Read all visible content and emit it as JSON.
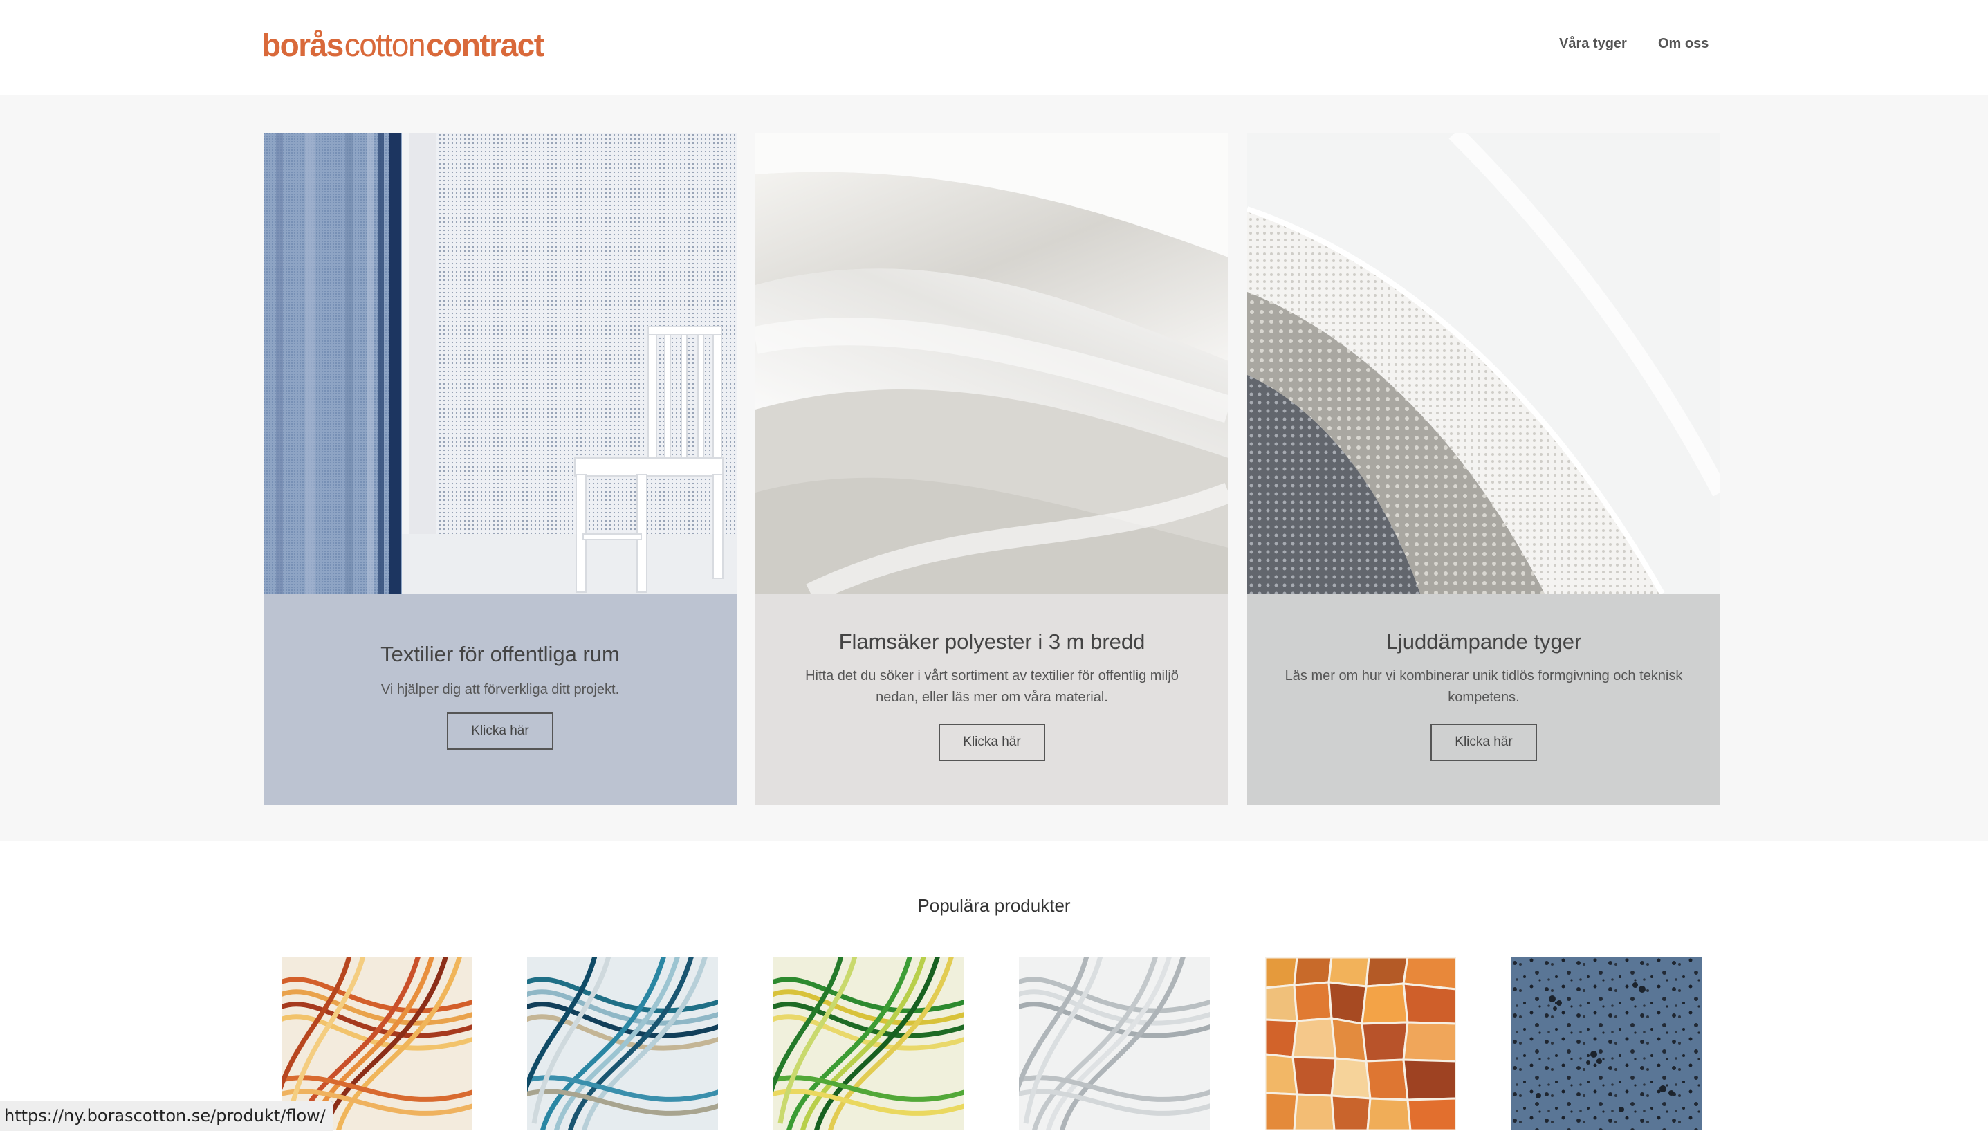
{
  "brand": {
    "part1": "borås",
    "part2": "cotton",
    "part3": "contract",
    "color": "#d9693a"
  },
  "nav": {
    "items": [
      "Våra tyger",
      "Om oss"
    ]
  },
  "hero": {
    "cards": [
      {
        "title": "Textilier för offentliga rum",
        "text": "Vi hjälper dig att förverkliga ditt projekt.",
        "button": "Klicka här",
        "color": "#bcc3d1"
      },
      {
        "title": "Flamsäker polyester i 3 m bredd",
        "text": "Hitta det du söker i vårt sortiment av textilier för offentlig miljö nedan, eller läs mer om våra material.",
        "button": "Klicka här",
        "color": "#e2e0df"
      },
      {
        "title": "Ljuddämpande tyger",
        "text": "Läs mer om hur vi kombinerar unik tidlös formgivning och teknisk kompetens.",
        "button": "Klicka här",
        "color": "#cfd0d0"
      }
    ]
  },
  "popular": {
    "title": "Populära produkter"
  },
  "status_url": "https://ny.borascotton.se/produkt/flow/"
}
